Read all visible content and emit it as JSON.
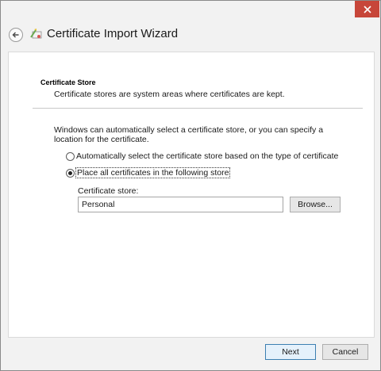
{
  "window": {
    "title": "Certificate Import Wizard"
  },
  "section": {
    "heading": "Certificate Store",
    "description": "Certificate stores are system areas where certificates are kept."
  },
  "intro_text": "Windows can automatically select a certificate store, or you can specify a location for the certificate.",
  "options": {
    "auto": {
      "label": "Automatically select the certificate store based on the type of certificate",
      "selected": false
    },
    "manual": {
      "label": "Place all certificates in the following store",
      "selected": true
    }
  },
  "store": {
    "label": "Certificate store:",
    "value": "Personal",
    "browse_label": "Browse..."
  },
  "footer": {
    "next_label": "Next",
    "cancel_label": "Cancel"
  },
  "icons": {
    "close": "close-icon",
    "back": "back-arrow-icon",
    "wizard": "certificate-wizard-icon"
  },
  "colors": {
    "close_button": "#c7463a",
    "default_button_border": "#3c7fb1"
  }
}
